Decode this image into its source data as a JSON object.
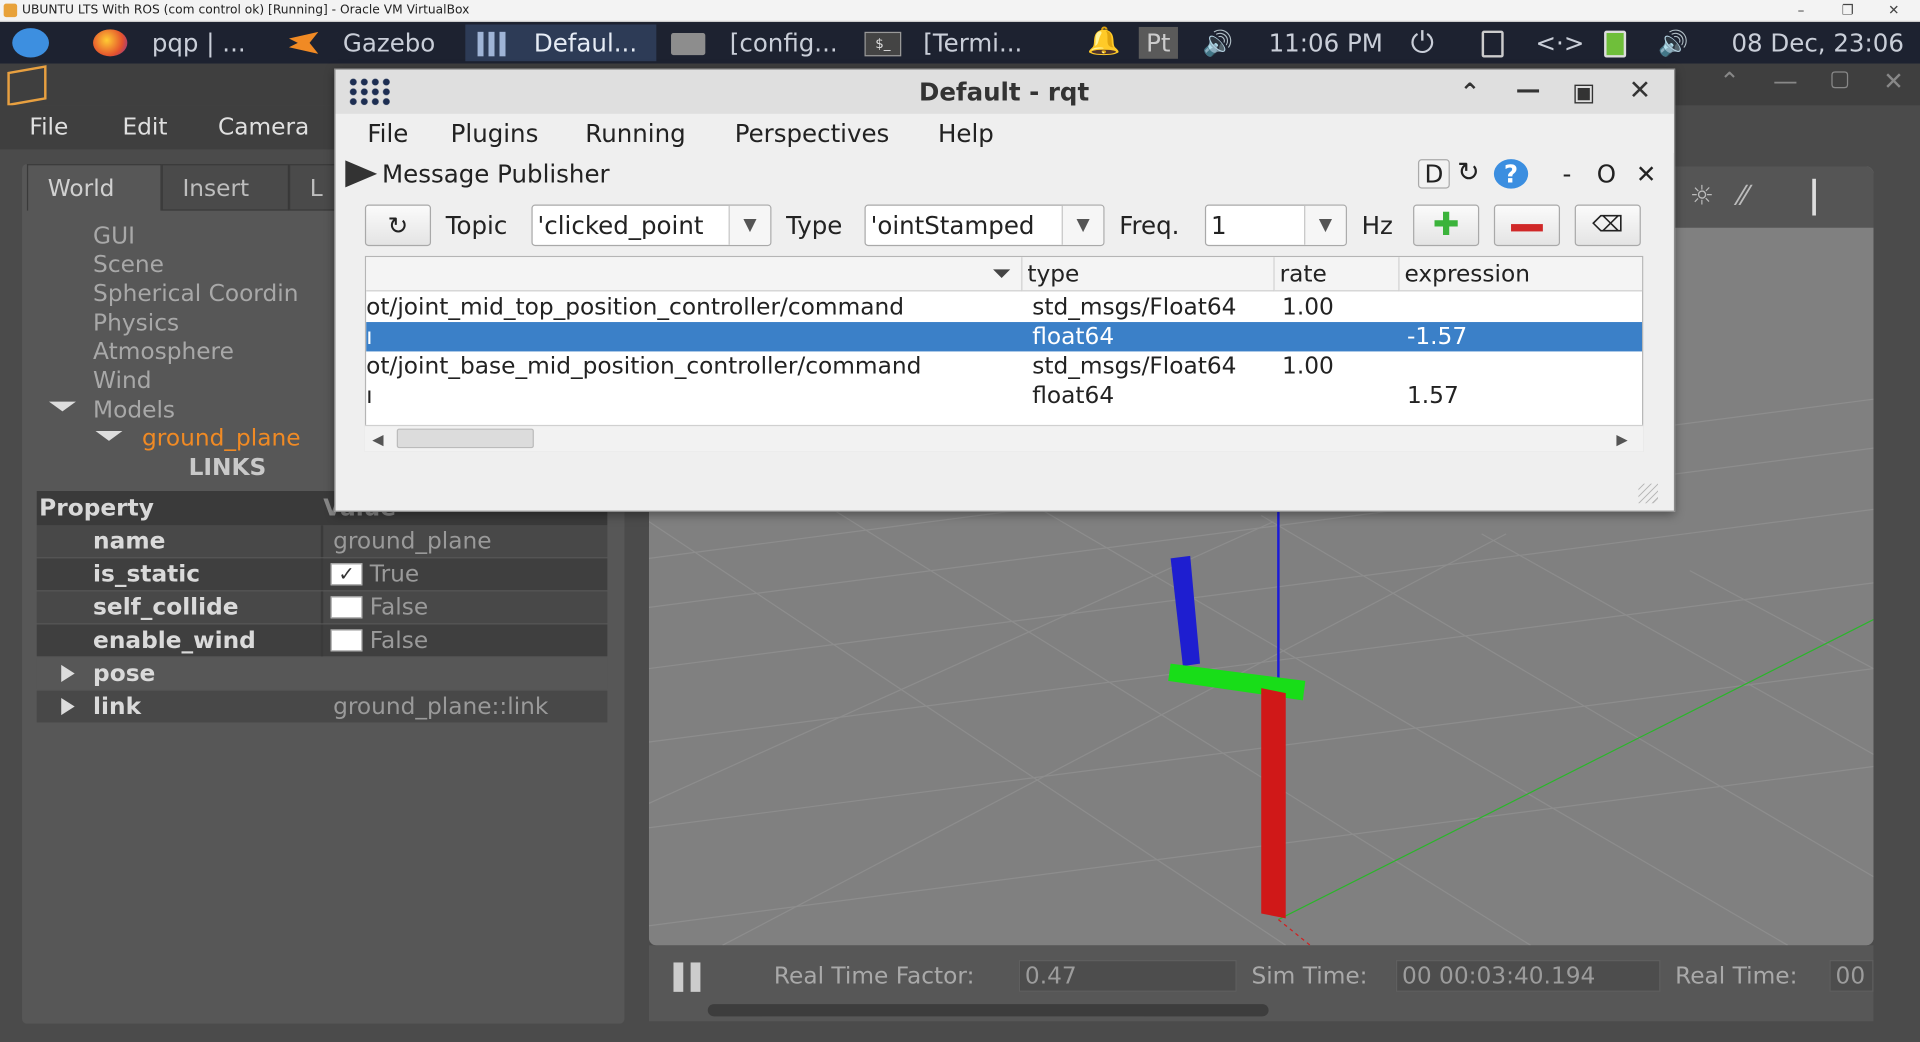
{
  "vbox": {
    "title": "UBUNTU LTS With ROS (com control ok) [Running] - Oracle VM VirtualBox",
    "min": "–",
    "restore": "❐",
    "close": "✕"
  },
  "panel": {
    "tasks": [
      {
        "label": "pqp | ..."
      },
      {
        "label": "Gazebo"
      },
      {
        "label": "Defaul..."
      },
      {
        "label": "[config..."
      },
      {
        "label": "[Termi..."
      }
    ],
    "keyboard": "Pt",
    "clock": "11:06 PM",
    "network": "<·>",
    "date": "08 Dec, 23:06"
  },
  "gazebo": {
    "menu": [
      "File",
      "Edit",
      "Camera"
    ],
    "tabs": [
      "World",
      "Insert",
      "L"
    ],
    "tree": [
      "GUI",
      "Scene",
      "Spherical Coordin",
      "Physics",
      "Atmosphere",
      "Wind",
      "Models"
    ],
    "model": "ground_plane",
    "links": "LINKS",
    "property_header": "Property",
    "value_header": "Value",
    "properties": [
      {
        "key": "name",
        "value": "ground_plane"
      },
      {
        "key": "is_static",
        "value": "True",
        "checked": "✓"
      },
      {
        "key": "self_collide",
        "value": "False"
      },
      {
        "key": "enable_wind",
        "value": "False"
      },
      {
        "key": "pose",
        "value": ""
      },
      {
        "key": "link",
        "value": "ground_plane::link"
      }
    ],
    "bottom": {
      "rtf_label": "Real Time Factor:",
      "rtf": "0.47",
      "sim_label": "Sim Time:",
      "sim": "00 00:03:40.194",
      "real_label": "Real Time:",
      "real": "00"
    }
  },
  "rqt": {
    "title": "Default - rqt",
    "menu": [
      "File",
      "Plugins",
      "Running",
      "Perspectives",
      "Help"
    ],
    "plugin": "Message Publisher",
    "plugin_btns": {
      "d": "D",
      "dash": "-",
      "o": "O",
      "x": "✕"
    },
    "topic_label": "Topic",
    "topic_value": "'clicked_point",
    "type_label": "Type",
    "type_value": "'ointStamped",
    "freq_label": "Freq.",
    "freq_value": "1",
    "hz_label": "Hz",
    "columns": [
      "",
      "type",
      "rate",
      "expression"
    ],
    "rows": [
      {
        "topic": "ot/joint_mid_top_position_controller/command",
        "type": "std_msgs/Float64",
        "rate": "1.00",
        "expr": ""
      },
      {
        "topic": "ı",
        "type": "float64",
        "rate": "",
        "expr": "-1.57"
      },
      {
        "topic": "ot/joint_base_mid_position_controller/command",
        "type": "std_msgs/Float64",
        "rate": "1.00",
        "expr": ""
      },
      {
        "topic": "ı",
        "type": "float64",
        "rate": "",
        "expr": "1.57"
      }
    ]
  }
}
